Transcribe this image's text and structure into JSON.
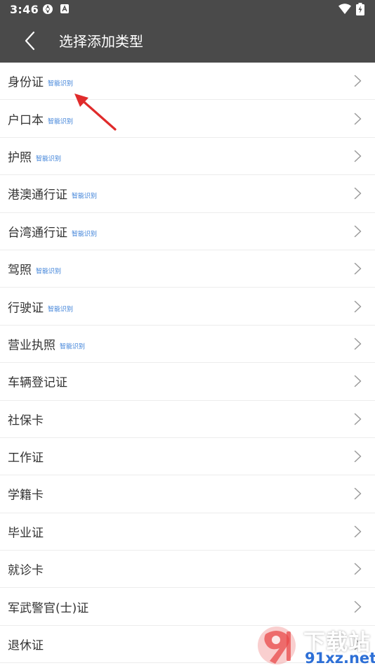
{
  "status_bar": {
    "time": "3:46"
  },
  "header": {
    "title": "选择添加类型"
  },
  "items": [
    {
      "label": "身份证",
      "tag": "智能识别"
    },
    {
      "label": "户口本",
      "tag": "智能识别"
    },
    {
      "label": "护照",
      "tag": "智能识别"
    },
    {
      "label": "港澳通行证",
      "tag": "智能识别"
    },
    {
      "label": "台湾通行证",
      "tag": "智能识别"
    },
    {
      "label": "驾照",
      "tag": "智能识别"
    },
    {
      "label": "行驶证",
      "tag": "智能识别"
    },
    {
      "label": "营业执照",
      "tag": "智能识别"
    },
    {
      "label": "车辆登记证",
      "tag": ""
    },
    {
      "label": "社保卡",
      "tag": ""
    },
    {
      "label": "工作证",
      "tag": ""
    },
    {
      "label": "学籍卡",
      "tag": ""
    },
    {
      "label": "毕业证",
      "tag": ""
    },
    {
      "label": "就诊卡",
      "tag": ""
    },
    {
      "label": "军武警官(士)证",
      "tag": ""
    },
    {
      "label": "退休证",
      "tag": ""
    }
  ],
  "watermark": {
    "line1": "下载站",
    "line2": "91xz.net"
  },
  "colors": {
    "header_bg": "#4a4a4a",
    "tag_blue": "#3a7fd8",
    "annotation_red": "#e02b2b"
  }
}
